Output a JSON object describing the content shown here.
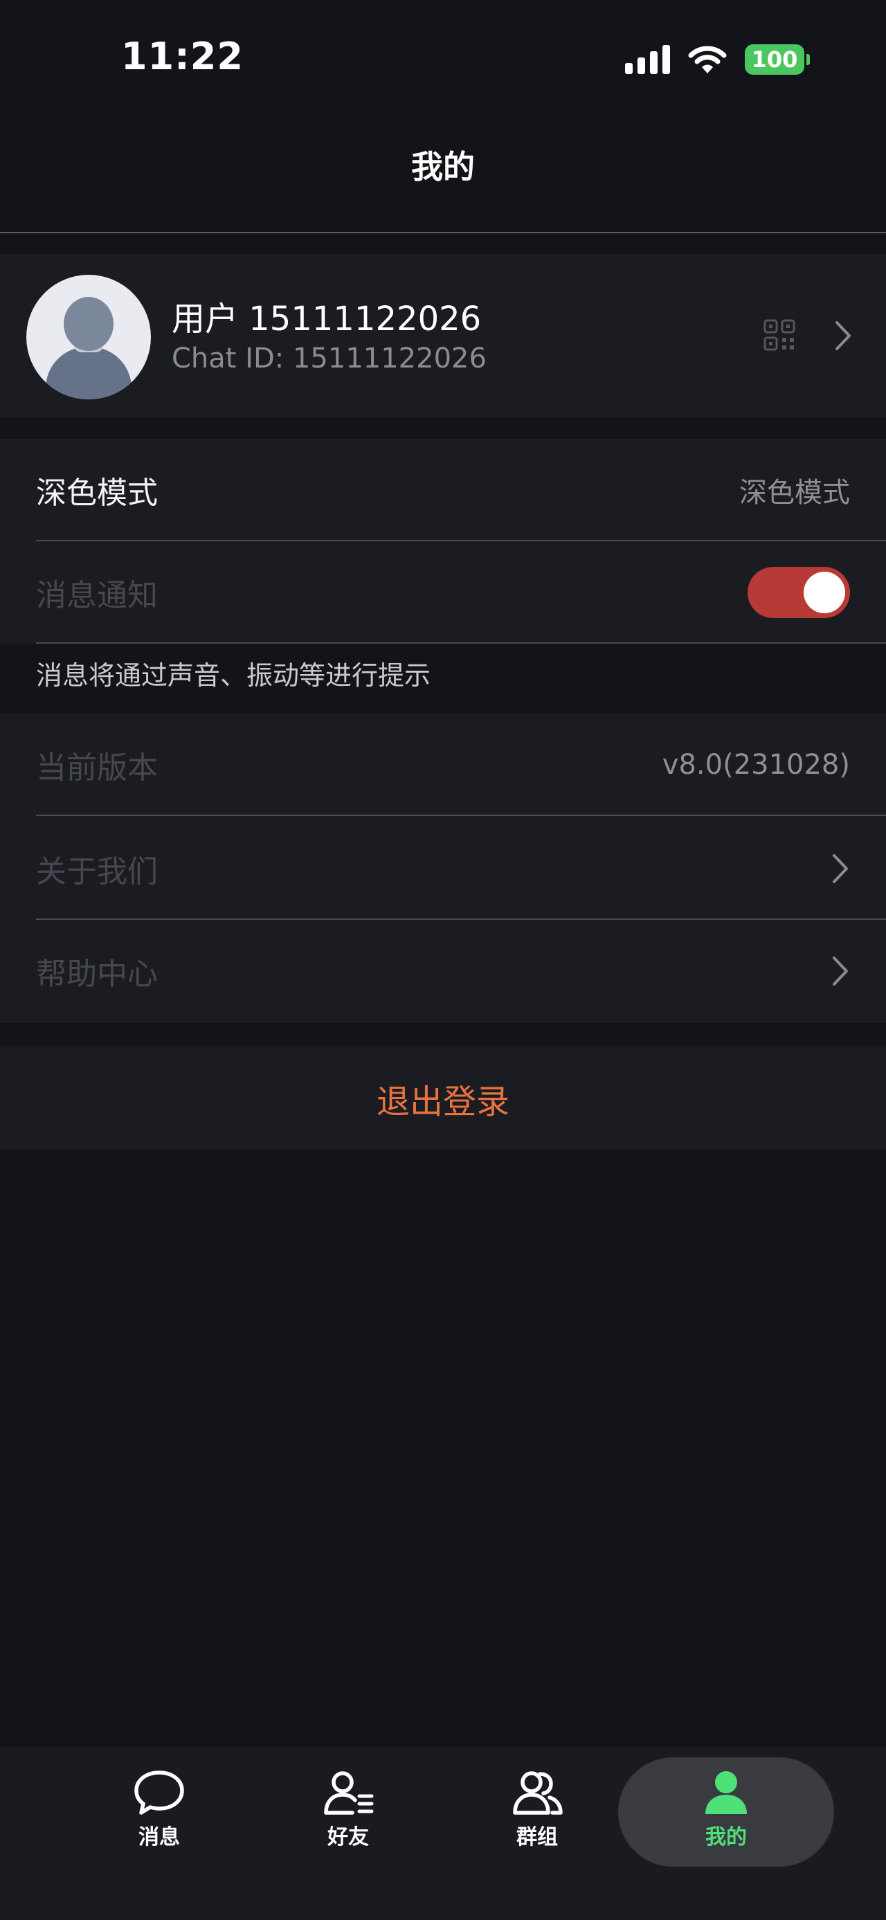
{
  "status_bar": {
    "time": "11:22",
    "battery": "100"
  },
  "header": {
    "title": "我的"
  },
  "profile": {
    "name": "用户 15111122026",
    "chat_id": "Chat ID: 15111122026"
  },
  "settings": {
    "dark_mode": {
      "label": "深色模式",
      "value": "深色模式"
    },
    "notifications": {
      "label": "消息通知",
      "enabled": true,
      "hint": "消息将通过声音、振动等进行提示"
    }
  },
  "about": {
    "version": {
      "label": "当前版本",
      "value": "v8.0(231028)"
    },
    "about_us": {
      "label": "关于我们"
    },
    "help_center": {
      "label": "帮助中心"
    }
  },
  "logout": {
    "label": "退出登录"
  },
  "tabbar": {
    "active": "我的",
    "tabs": [
      {
        "label": "消息",
        "icon": "chat-bubble-icon"
      },
      {
        "label": "好友",
        "icon": "contacts-icon"
      },
      {
        "label": "群组",
        "icon": "group-icon"
      },
      {
        "label": "我的",
        "icon": "person-icon"
      }
    ]
  },
  "colors": {
    "background": "#131419",
    "card": "#1b1c21",
    "toggle_on": "#b83a37",
    "logout": "#e8733f",
    "tab_active": "#4fe07a"
  }
}
